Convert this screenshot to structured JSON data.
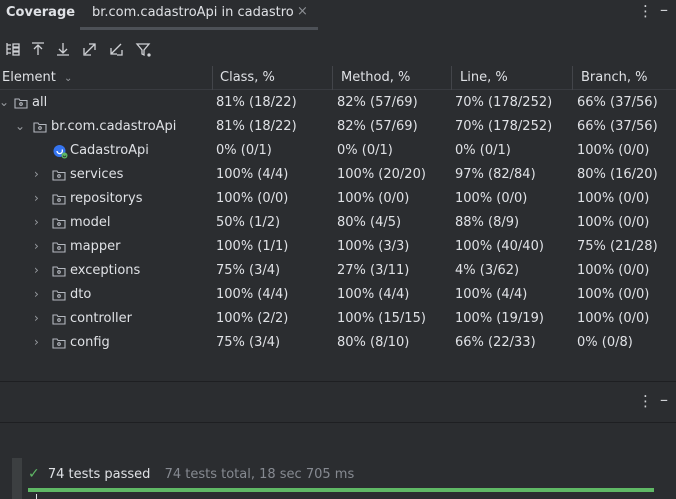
{
  "tabs": {
    "panel_title": "Coverage",
    "active_tab": "br.com.cadastroApi in cadastro",
    "close_glyph": "×",
    "more_glyph": "⋮",
    "minimize_glyph": "–"
  },
  "toolbar": {
    "icons": [
      "flatten-packages-icon",
      "expand-all-icon",
      "collapse-all-icon",
      "navigate-icon",
      "import-icon",
      "filter-icon"
    ]
  },
  "table": {
    "headers": {
      "element": "Element",
      "class": "Class, %",
      "method": "Method, %",
      "line": "Line, %",
      "branch": "Branch, %"
    },
    "rows": [
      {
        "name": "all",
        "class": "81% (18/22)",
        "method": "82% (57/69)",
        "line": "70% (178/252)",
        "branch": "66% (37/56)"
      },
      {
        "name": "br.com.cadastroApi",
        "class": "81% (18/22)",
        "method": "82% (57/69)",
        "line": "70% (178/252)",
        "branch": "66% (37/56)"
      },
      {
        "name": "CadastroApi",
        "class": "0% (0/1)",
        "method": "0% (0/1)",
        "line": "0% (0/1)",
        "branch": "100% (0/0)"
      },
      {
        "name": "services",
        "class": "100% (4/4)",
        "method": "100% (20/20)",
        "line": "97% (82/84)",
        "branch": "80% (16/20)"
      },
      {
        "name": "repositorys",
        "class": "100% (0/0)",
        "method": "100% (0/0)",
        "line": "100% (0/0)",
        "branch": "100% (0/0)"
      },
      {
        "name": "model",
        "class": "50% (1/2)",
        "method": "80% (4/5)",
        "line": "88% (8/9)",
        "branch": "100% (0/0)"
      },
      {
        "name": "mapper",
        "class": "100% (1/1)",
        "method": "100% (3/3)",
        "line": "100% (40/40)",
        "branch": "75% (21/28)"
      },
      {
        "name": "exceptions",
        "class": "75% (3/4)",
        "method": "27% (3/11)",
        "line": "4% (3/62)",
        "branch": "100% (0/0)"
      },
      {
        "name": "dto",
        "class": "100% (4/4)",
        "method": "100% (4/4)",
        "line": "100% (4/4)",
        "branch": "100% (0/0)"
      },
      {
        "name": "controller",
        "class": "100% (2/2)",
        "method": "100% (15/15)",
        "line": "100% (19/19)",
        "branch": "100% (0/0)"
      },
      {
        "name": "config",
        "class": "75% (3/4)",
        "method": "80% (8/10)",
        "line": "66% (22/33)",
        "branch": "0% (0/8)"
      }
    ]
  },
  "tests": {
    "passed": "74 tests passed",
    "detail": "74 tests total, 18 sec 705 ms",
    "check_glyph": "✓"
  },
  "colors": {
    "background": "#2b2d30",
    "success": "#5fb865",
    "text": "#dfe1e5",
    "muted": "#868a91"
  }
}
